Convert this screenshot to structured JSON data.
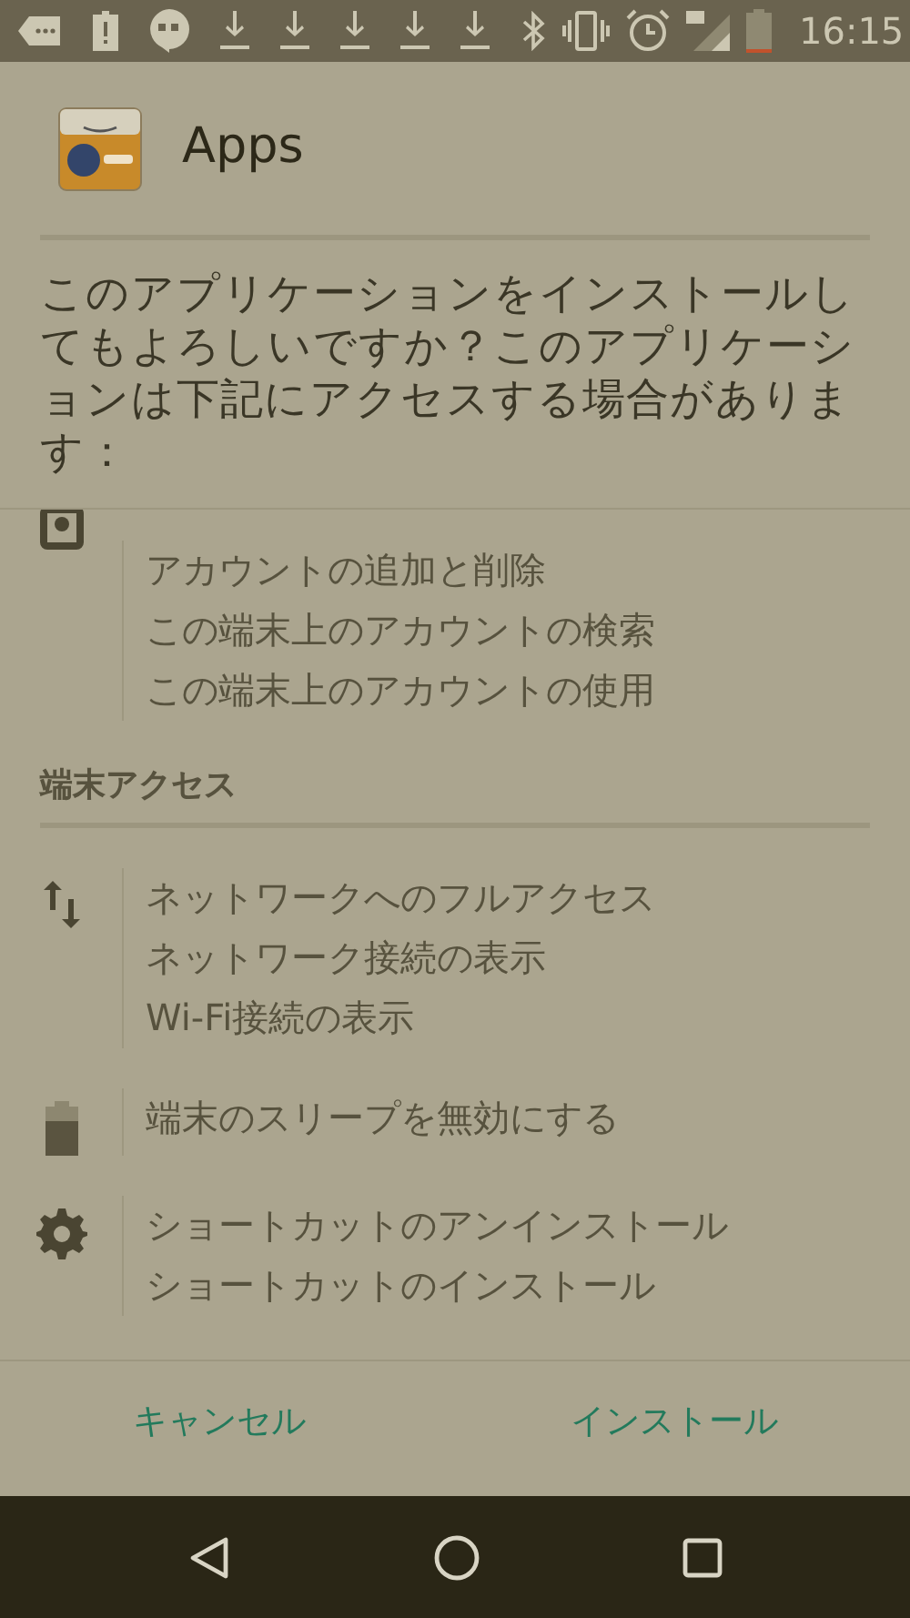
{
  "status_bar": {
    "time": "16:15"
  },
  "dialog": {
    "title": "Apps",
    "message": "このアプリケーションをインストールしてもよろしいですか？このアプリケーションは下記にアクセスする場合があります：",
    "permission_list": [
      {
        "kind": "account-group",
        "items": [
          "アカウントの追加と削除",
          "この端末上のアカウントの検索",
          "この端末上のアカウントの使用"
        ]
      },
      {
        "kind": "heading",
        "text": "端末アクセス"
      },
      {
        "kind": "network-group",
        "items": [
          "ネットワークへのフルアクセス",
          "ネットワーク接続の表示",
          "Wi-Fi接続の表示"
        ]
      },
      {
        "kind": "battery-group",
        "items": [
          "端末のスリープを無効にする"
        ]
      },
      {
        "kind": "settings-group",
        "items": [
          "ショートカットのアンインストール",
          "ショートカットのインストール"
        ]
      }
    ],
    "buttons": [
      "キャンセル",
      "インストール"
    ]
  }
}
